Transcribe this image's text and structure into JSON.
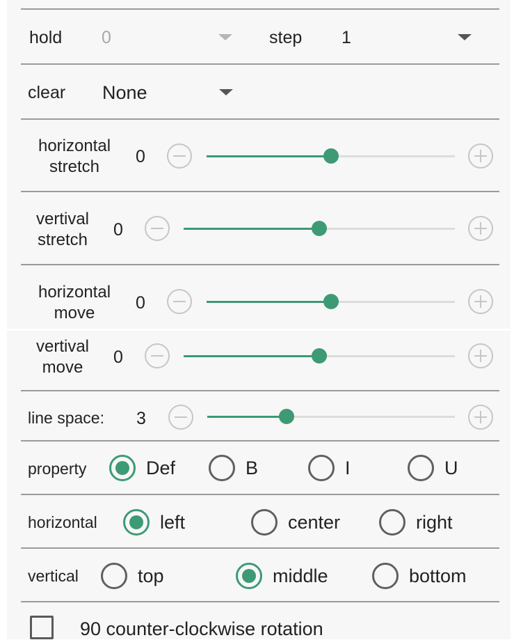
{
  "hold": {
    "label": "hold",
    "value": "0"
  },
  "step": {
    "label": "step",
    "value": "1"
  },
  "clear": {
    "label": "clear",
    "value": "None"
  },
  "sliders": [
    {
      "label_line1": "horizontal",
      "label_line2": "stretch",
      "value": "0",
      "fraction": 0.5
    },
    {
      "label_line1": "vertival",
      "label_line2": "stretch",
      "value": "0",
      "fraction": 0.5
    },
    {
      "label_line1": "horizontal",
      "label_line2": "move",
      "value": "0",
      "fraction": 0.5
    },
    {
      "label_line1": "vertival",
      "label_line2": "move",
      "value": "0",
      "fraction": 0.5
    },
    {
      "label": "line space:",
      "value": "3",
      "fraction": 0.32
    }
  ],
  "property": {
    "label": "property",
    "options": [
      "Def",
      "B",
      "I",
      "U"
    ],
    "selected": "Def"
  },
  "horizontal": {
    "label": "horizontal",
    "options": [
      "left",
      "center",
      "right"
    ],
    "selected": "left"
  },
  "vertical": {
    "label": "vertical",
    "options": [
      "top",
      "middle",
      "bottom"
    ],
    "selected": "middle"
  },
  "rotation": {
    "label": "90 counter-clockwise rotation",
    "checked": false
  },
  "colors": {
    "accent": "#3d9a74",
    "divider": "#9a9a9a",
    "track": "#dcdcdc"
  },
  "icons": {
    "minus": "minus-circle-icon",
    "plus": "plus-circle-icon",
    "dropdown": "chevron-down-icon"
  }
}
